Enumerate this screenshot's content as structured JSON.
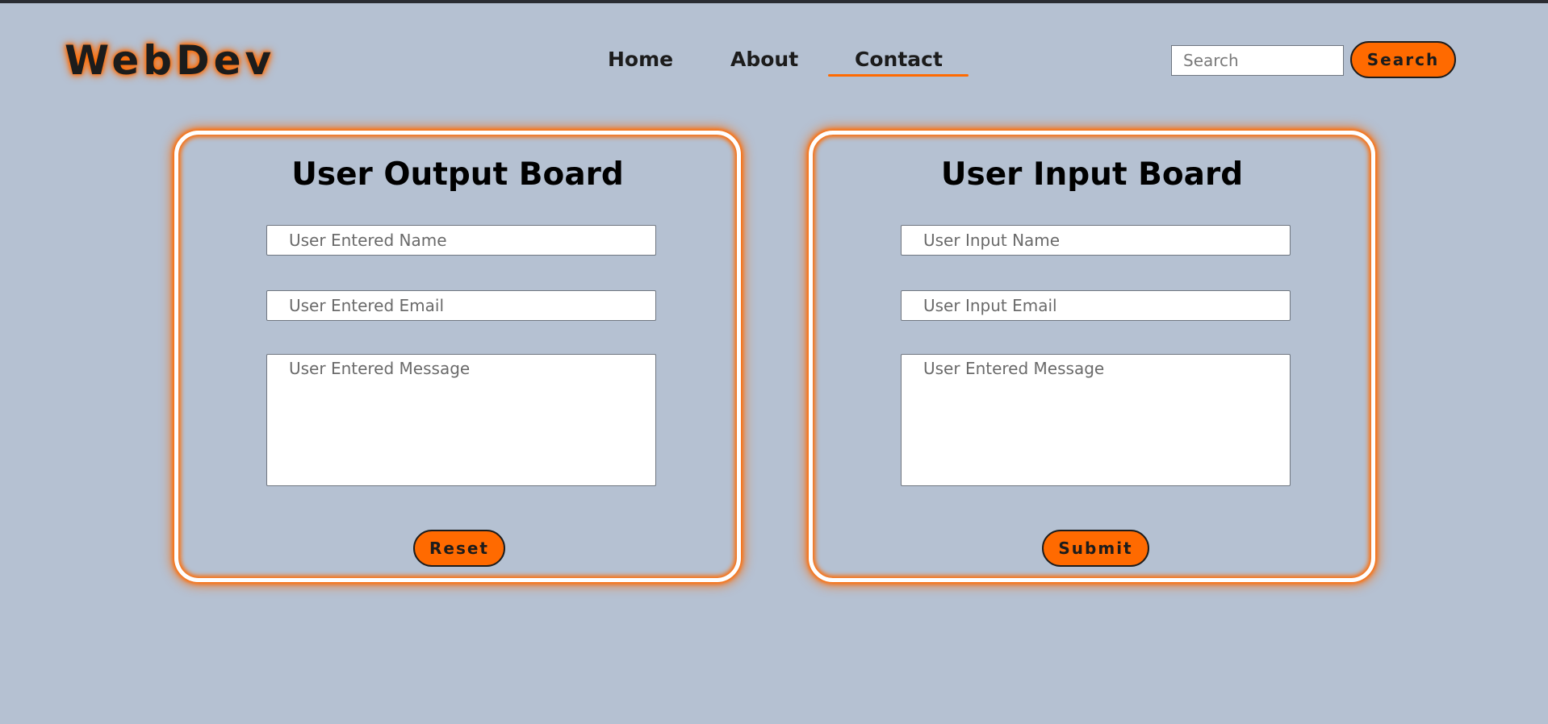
{
  "header": {
    "logo": "WebDev",
    "nav": {
      "home": "Home",
      "about": "About",
      "contact": "Contact",
      "active": "Contact"
    },
    "search": {
      "placeholder": "Search",
      "button_label": "Search"
    }
  },
  "output_board": {
    "title": "User Output Board",
    "name_placeholder": "User Entered Name",
    "email_placeholder": "User Entered Email",
    "message_placeholder": "User Entered Message",
    "button_label": "Reset"
  },
  "input_board": {
    "title": "User Input Board",
    "name_placeholder": "User Input Name",
    "email_placeholder": "User Input Email",
    "message_placeholder": "User Entered Message",
    "button_label": "Submit"
  },
  "colors": {
    "background": "#b5c1d2",
    "accent": "#ff6a00",
    "board_border": "#ffffff",
    "text": "#1c1c1c"
  }
}
